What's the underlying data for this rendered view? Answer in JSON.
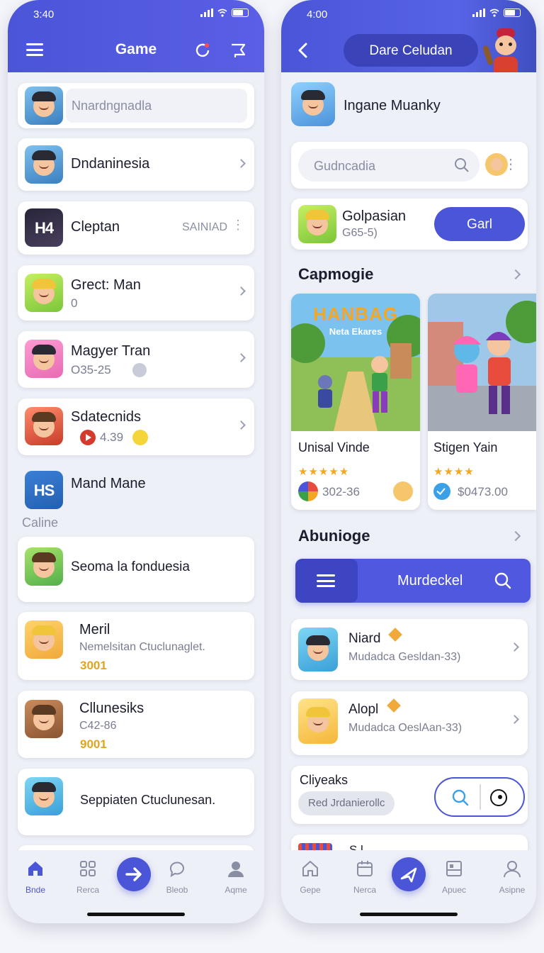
{
  "left": {
    "status": {
      "time": "3:40"
    },
    "header": {
      "title": "Game"
    },
    "search": {
      "placeholder": "Nnardngnadla"
    },
    "items": [
      {
        "name": "Dndaninesia"
      },
      {
        "name": "Cleptan",
        "tag": "SAINIAD",
        "logo": "H4"
      },
      {
        "name": "Grect: Man",
        "sub": "0"
      },
      {
        "name": "Magyer Tran",
        "sub": "O35-25"
      },
      {
        "name": "Sdatecnids",
        "sub": "4.39"
      },
      {
        "name": "Mand Mane",
        "logo": "HS"
      },
      {
        "name": "Seoma la fonduesia"
      },
      {
        "name": "Meril",
        "sub": "Nemelsitan Ctuclunaglet.",
        "gold": "3001"
      },
      {
        "name": "Cllunesiks",
        "sub": "C42-86",
        "gold": "9001"
      },
      {
        "name": "Seppiaten Ctuclunesan."
      }
    ],
    "section_label": "Caline",
    "tabs": [
      {
        "label": "Bnde",
        "icon": "home-icon"
      },
      {
        "label": "Rerca",
        "icon": "grid-icon"
      },
      {
        "label": "Bleob",
        "icon": "chat-icon"
      },
      {
        "label": "Aqme",
        "icon": "profile-icon"
      }
    ]
  },
  "right": {
    "status": {
      "time": "4:00"
    },
    "header": {
      "title": "Dare Celudan"
    },
    "profile": {
      "name": "Ingane Muanky"
    },
    "search": {
      "placeholder": "Gudncadia"
    },
    "featured": {
      "name": "Golpasian",
      "sub": "G65-5)",
      "button": "Garl"
    },
    "section1": {
      "title": "Capmogie"
    },
    "games": [
      {
        "art_title": "HANBAG",
        "art_subtitle": "Neta Ekares",
        "name": "Unisal Vinde",
        "stars": "★★★★★",
        "meta": "302-36"
      },
      {
        "name": "Stigen Yain",
        "stars": "★★★★",
        "meta": "$0473.00"
      }
    ],
    "section2": {
      "title": "Abunioge"
    },
    "toolbar": {
      "label": "Murdeckel"
    },
    "list": [
      {
        "name": "Niard",
        "sub": "Mudadca Gesldan-33)"
      },
      {
        "name": "Alopl",
        "sub": "Mudadca OeslAan-33)"
      }
    ],
    "chip_card": {
      "title": "Cliyeaks",
      "chip": "Red Jrdanierollc"
    },
    "partial": {
      "text": "S.l"
    },
    "tabs": [
      {
        "label": "Gepe",
        "icon": "home-icon"
      },
      {
        "label": "Nerca",
        "icon": "calendar-icon"
      },
      {
        "label": "Apuec",
        "icon": "layout-icon"
      },
      {
        "label": "Asipne",
        "icon": "profile-icon"
      }
    ]
  },
  "colors": {
    "accent": "#4b55d8",
    "gold": "#e0a51c",
    "star": "#f5a623"
  }
}
